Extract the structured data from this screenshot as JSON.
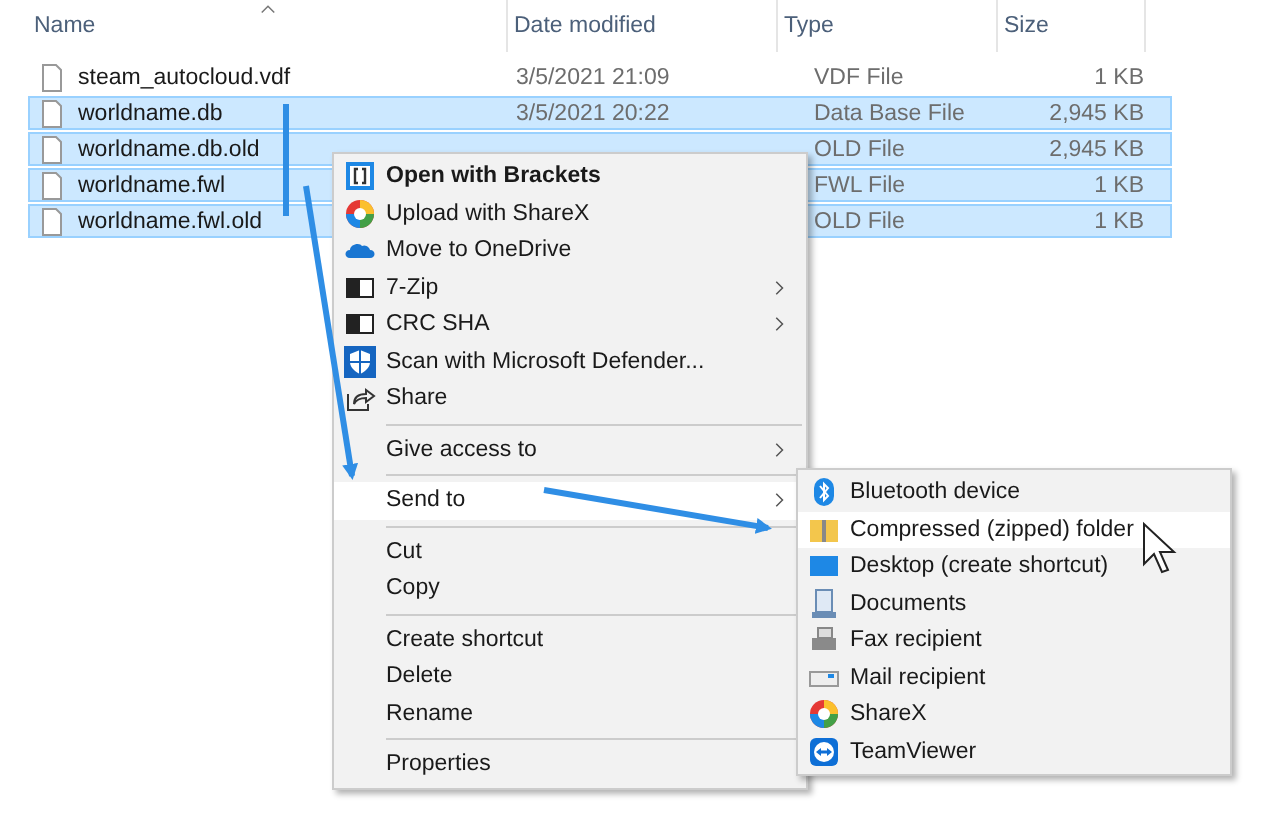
{
  "table": {
    "columns": [
      {
        "label": "Name",
        "sorted": true
      },
      {
        "label": "Date modified",
        "sorted": false
      },
      {
        "label": "Type",
        "sorted": false
      },
      {
        "label": "Size",
        "sorted": false
      }
    ],
    "rows": [
      {
        "name": "steam_autocloud.vdf",
        "date": "3/5/2021 21:09",
        "type": "VDF File",
        "size": "1 KB",
        "selected": false
      },
      {
        "name": "worldname.db",
        "date": "3/5/2021 20:22",
        "type": "Data Base File",
        "size": "2,945 KB",
        "selected": true
      },
      {
        "name": "worldname.db.old",
        "date": "",
        "type": "OLD File",
        "size": "2,945 KB",
        "selected": true
      },
      {
        "name": "worldname.fwl",
        "date": "",
        "type": "FWL File",
        "size": "1 KB",
        "selected": true
      },
      {
        "name": "worldname.fwl.old",
        "date": "",
        "type": "OLD File",
        "size": "1 KB",
        "selected": true
      }
    ]
  },
  "context_menu": {
    "items": [
      {
        "kind": "item",
        "label": "Open with Brackets",
        "bold": true,
        "submenu": false,
        "selected": false
      },
      {
        "kind": "item",
        "label": "Upload with ShareX",
        "bold": false,
        "submenu": false,
        "selected": false
      },
      {
        "kind": "item",
        "label": "Move to OneDrive",
        "bold": false,
        "submenu": false,
        "selected": false
      },
      {
        "kind": "item",
        "label": "7-Zip",
        "bold": false,
        "submenu": true,
        "selected": false
      },
      {
        "kind": "item",
        "label": "CRC SHA",
        "bold": false,
        "submenu": true,
        "selected": false
      },
      {
        "kind": "item",
        "label": "Scan with Microsoft Defender...",
        "bold": false,
        "submenu": false,
        "selected": false
      },
      {
        "kind": "item",
        "label": "Share",
        "bold": false,
        "submenu": false,
        "selected": false
      },
      {
        "kind": "separator"
      },
      {
        "kind": "item",
        "label": "Give access to",
        "bold": false,
        "submenu": true,
        "selected": false
      },
      {
        "kind": "separator"
      },
      {
        "kind": "item",
        "label": "Send to",
        "bold": false,
        "submenu": true,
        "selected": true
      },
      {
        "kind": "separator"
      },
      {
        "kind": "item",
        "label": "Cut",
        "bold": false,
        "submenu": false,
        "selected": false
      },
      {
        "kind": "item",
        "label": "Copy",
        "bold": false,
        "submenu": false,
        "selected": false
      },
      {
        "kind": "separator"
      },
      {
        "kind": "item",
        "label": "Create shortcut",
        "bold": false,
        "submenu": false,
        "selected": false
      },
      {
        "kind": "item",
        "label": "Delete",
        "bold": false,
        "submenu": false,
        "selected": false
      },
      {
        "kind": "item",
        "label": "Rename",
        "bold": false,
        "submenu": false,
        "selected": false
      },
      {
        "kind": "separator"
      },
      {
        "kind": "item",
        "label": "Properties",
        "bold": false,
        "submenu": false,
        "selected": false
      }
    ]
  },
  "send_to_menu": {
    "items": [
      {
        "label": "Bluetooth device",
        "selected": false
      },
      {
        "label": "Compressed (zipped) folder",
        "selected": true
      },
      {
        "label": "Desktop (create shortcut)",
        "selected": false
      },
      {
        "label": "Documents",
        "selected": false
      },
      {
        "label": "Fax recipient",
        "selected": false
      },
      {
        "label": "Mail recipient",
        "selected": false
      },
      {
        "label": "ShareX",
        "selected": false
      },
      {
        "label": "TeamViewer",
        "selected": false
      }
    ]
  }
}
